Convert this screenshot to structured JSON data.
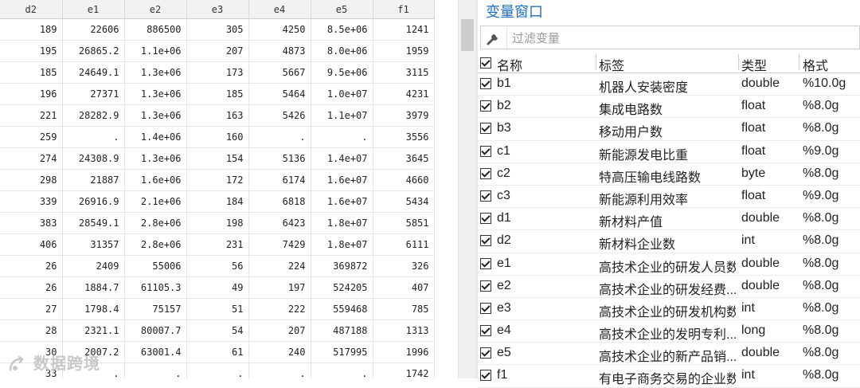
{
  "grid": {
    "columns": [
      "d2",
      "e1",
      "e2",
      "e3",
      "e4",
      "e5",
      "f1"
    ],
    "rows": [
      [
        "189",
        "22606",
        "886500",
        "305",
        "4250",
        "8.5e+06",
        "1241"
      ],
      [
        "195",
        "26865.2",
        "1.1e+06",
        "207",
        "4873",
        "8.0e+06",
        "1959"
      ],
      [
        "185",
        "24649.1",
        "1.3e+06",
        "173",
        "5667",
        "9.5e+06",
        "3115"
      ],
      [
        "196",
        "27371",
        "1.3e+06",
        "185",
        "5464",
        "1.0e+07",
        "4231"
      ],
      [
        "221",
        "28282.9",
        "1.3e+06",
        "163",
        "5426",
        "1.1e+07",
        "3979"
      ],
      [
        "259",
        ".",
        "1.4e+06",
        "160",
        ".",
        ".",
        "3556"
      ],
      [
        "274",
        "24308.9",
        "1.3e+06",
        "154",
        "5136",
        "1.4e+07",
        "3645"
      ],
      [
        "298",
        "21887",
        "1.6e+06",
        "172",
        "6174",
        "1.6e+07",
        "4660"
      ],
      [
        "339",
        "26916.9",
        "2.1e+06",
        "184",
        "6818",
        "1.6e+07",
        "5434"
      ],
      [
        "383",
        "28549.1",
        "2.8e+06",
        "198",
        "6423",
        "1.8e+07",
        "5851"
      ],
      [
        "406",
        "31357",
        "2.8e+06",
        "231",
        "7429",
        "1.8e+07",
        "6111"
      ],
      [
        "26",
        "2409",
        "55006",
        "56",
        "224",
        "369872",
        "326"
      ],
      [
        "26",
        "1884.7",
        "61105.3",
        "49",
        "197",
        "524205",
        "407"
      ],
      [
        "27",
        "1798.4",
        "75157",
        "51",
        "222",
        "559468",
        "785"
      ],
      [
        "28",
        "2321.1",
        "80007.7",
        "54",
        "207",
        "487188",
        "1313"
      ],
      [
        "30",
        "2007.2",
        "63001.4",
        "61",
        "240",
        "517995",
        "1996"
      ],
      [
        "33",
        ".",
        ".",
        ".",
        ".",
        ".",
        "1742"
      ]
    ]
  },
  "watermark": {
    "text": "数据跨境",
    "icon": "brand-logo-icon"
  },
  "panel": {
    "title": "变量窗口",
    "filter_placeholder": "过滤变量",
    "filter_icon": "wrench-icon",
    "headers": {
      "name": "名称",
      "label": "标签",
      "type": "类型",
      "format": "格式"
    },
    "variables": [
      {
        "name": "b1",
        "label": "机器人安装密度",
        "type": "double",
        "format": "%10.0g"
      },
      {
        "name": "b2",
        "label": "集成电路数",
        "type": "float",
        "format": "%8.0g"
      },
      {
        "name": "b3",
        "label": "移动用户数",
        "type": "float",
        "format": "%8.0g"
      },
      {
        "name": "c1",
        "label": "新能源发电比重",
        "type": "float",
        "format": "%9.0g"
      },
      {
        "name": "c2",
        "label": "特高压输电线路数",
        "type": "byte",
        "format": "%8.0g"
      },
      {
        "name": "c3",
        "label": "新能源利用效率",
        "type": "float",
        "format": "%9.0g"
      },
      {
        "name": "d1",
        "label": "新材料产值",
        "type": "double",
        "format": "%8.0g"
      },
      {
        "name": "d2",
        "label": "新材料企业数",
        "type": "int",
        "format": "%8.0g"
      },
      {
        "name": "e1",
        "label": "高技术企业的研发人员数",
        "type": "double",
        "format": "%8.0g"
      },
      {
        "name": "e2",
        "label": "高技术企业的研发经费...",
        "type": "double",
        "format": "%8.0g"
      },
      {
        "name": "e3",
        "label": "高技术企业的研发机构数",
        "type": "int",
        "format": "%8.0g"
      },
      {
        "name": "e4",
        "label": "高技术企业的发明专利...",
        "type": "long",
        "format": "%8.0g"
      },
      {
        "name": "e5",
        "label": "高技术企业的新产品销...",
        "type": "double",
        "format": "%8.0g"
      },
      {
        "name": "f1",
        "label": "有电子商务交易的企业数",
        "type": "int",
        "format": "%8.0g"
      }
    ]
  },
  "colors": {
    "title": "#1f6fc5",
    "header_bg": "#f2f2f2"
  }
}
